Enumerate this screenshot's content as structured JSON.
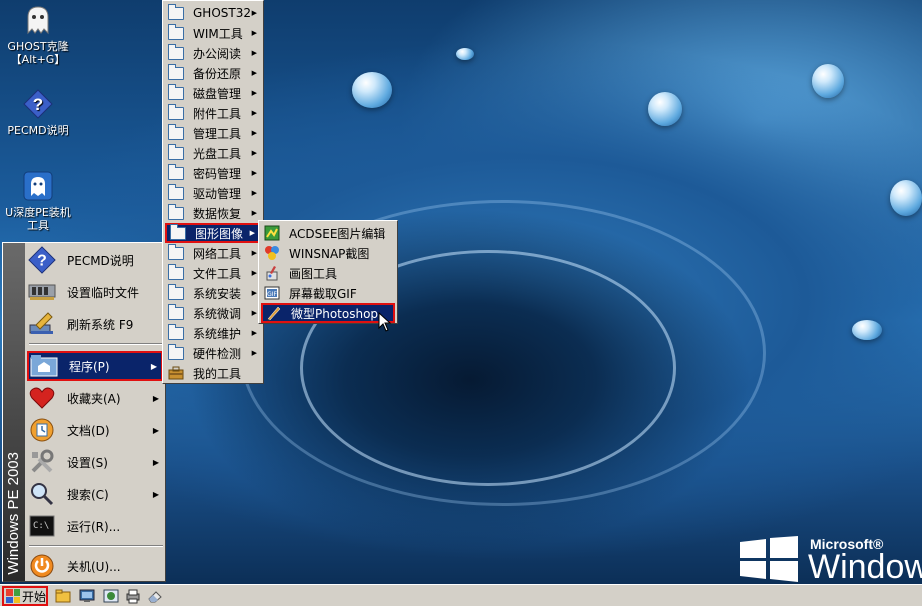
{
  "desktop": {
    "icons": [
      {
        "label_line1": "GHOST克隆",
        "label_line2": "【Alt+G】"
      },
      {
        "label_line1": "PECMD说明",
        "label_line2": ""
      },
      {
        "label_line1": "U深度PE装机",
        "label_line2": "工具"
      }
    ],
    "logo_brand": "Microsoft®",
    "logo_word": "Windows"
  },
  "start_menu": {
    "banner": "Windows PE 2003",
    "items": [
      {
        "label": "PECMD说明",
        "icon": "help-icon",
        "submenu": false
      },
      {
        "label": "设置临时文件",
        "icon": "memory-icon",
        "submenu": false
      },
      {
        "label": "刷新系统 F9",
        "icon": "refresh-paint-icon",
        "submenu": false
      },
      {
        "label": "程序(P)",
        "icon": "programs-icon",
        "submenu": true
      },
      {
        "label": "收藏夹(A)",
        "icon": "heart-icon",
        "submenu": true
      },
      {
        "label": "文档(D)",
        "icon": "documents-icon",
        "submenu": true
      },
      {
        "label": "设置(S)",
        "icon": "settings-icon",
        "submenu": true
      },
      {
        "label": "搜索(C)",
        "icon": "search-icon",
        "submenu": true
      },
      {
        "label": "运行(R)...",
        "icon": "run-icon",
        "submenu": false
      },
      {
        "label": "关机(U)...",
        "icon": "shutdown-icon",
        "submenu": false
      }
    ]
  },
  "programs_menu": {
    "items": [
      {
        "label": "GHOST32",
        "submenu": true
      },
      {
        "label": "WIM工具",
        "submenu": true
      },
      {
        "label": "办公阅读",
        "submenu": true
      },
      {
        "label": "备份还原",
        "submenu": true
      },
      {
        "label": "磁盘管理",
        "submenu": true
      },
      {
        "label": "附件工具",
        "submenu": true
      },
      {
        "label": "管理工具",
        "submenu": true
      },
      {
        "label": "光盘工具",
        "submenu": true
      },
      {
        "label": "密码管理",
        "submenu": true
      },
      {
        "label": "驱动管理",
        "submenu": true
      },
      {
        "label": "数据恢复",
        "submenu": true
      },
      {
        "label": "图形图像",
        "submenu": true
      },
      {
        "label": "网络工具",
        "submenu": true
      },
      {
        "label": "文件工具",
        "submenu": true
      },
      {
        "label": "系统安装",
        "submenu": true
      },
      {
        "label": "系统微调",
        "submenu": true
      },
      {
        "label": "系统维护",
        "submenu": true
      },
      {
        "label": "硬件检测",
        "submenu": true
      },
      {
        "label": "我的工具",
        "submenu": false
      }
    ]
  },
  "graphics_menu": {
    "items": [
      {
        "label": "ACDSEE图片编辑"
      },
      {
        "label": "WINSNAP截图"
      },
      {
        "label": "画图工具"
      },
      {
        "label": "屏幕截取GIF"
      },
      {
        "label": "微型Photoshop"
      }
    ]
  },
  "taskbar": {
    "start_label": "开始"
  },
  "colors": {
    "highlight": "#0a246a",
    "annotation_red": "#e01010",
    "menu_bg": "#d4d0c8"
  }
}
